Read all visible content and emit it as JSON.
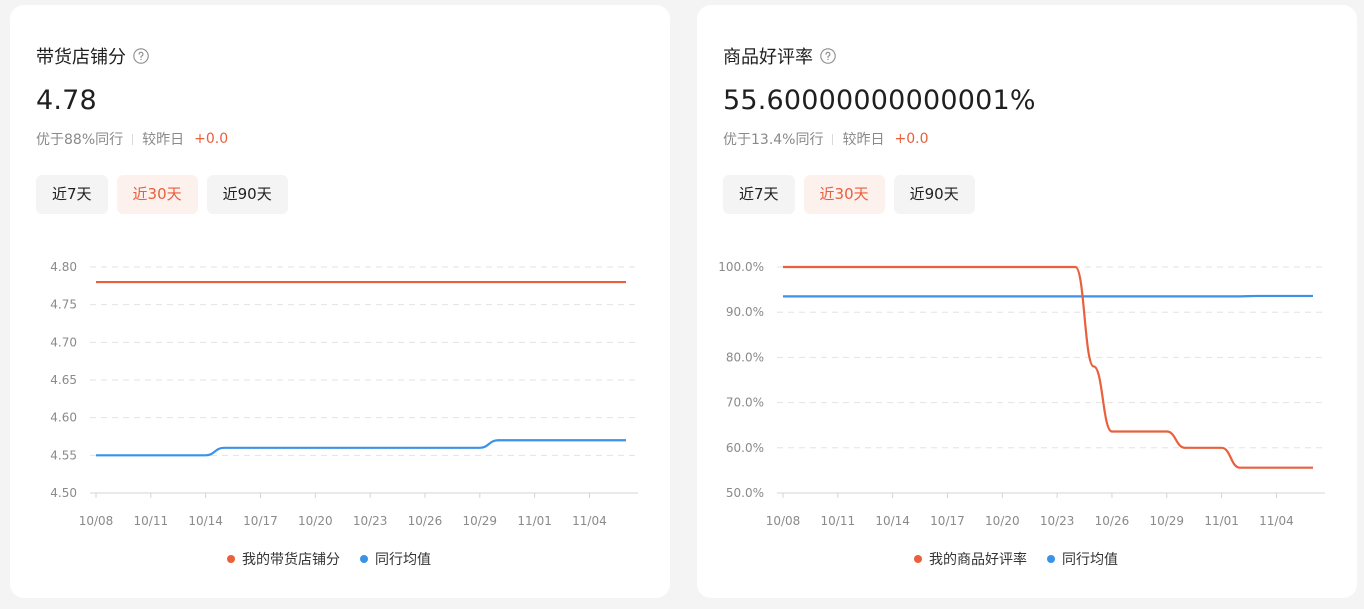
{
  "cards": [
    {
      "title": "带货店铺分",
      "value": "4.78",
      "compare": "优于88%同行",
      "day_label": "较昨日",
      "delta": "+0.0",
      "tabs": [
        "近7天",
        "近30天",
        "近90天"
      ],
      "active_tab": "近30天",
      "colors": {
        "mine": "#e8603c",
        "peer": "#3a93e8"
      }
    },
    {
      "title": "商品好评率",
      "value": "55.60000000000001%",
      "compare": "优于13.4%同行",
      "day_label": "较昨日",
      "delta": "+0.0",
      "tabs": [
        "近7天",
        "近30天",
        "近90天"
      ],
      "active_tab": "近30天",
      "colors": {
        "mine": "#e8603c",
        "peer": "#3a93e8"
      }
    }
  ],
  "chart_data": [
    {
      "type": "line",
      "x": [
        "10/08",
        "10/09",
        "10/10",
        "10/11",
        "10/12",
        "10/13",
        "10/14",
        "10/15",
        "10/16",
        "10/17",
        "10/18",
        "10/19",
        "10/20",
        "10/21",
        "10/22",
        "10/23",
        "10/24",
        "10/25",
        "10/26",
        "10/27",
        "10/28",
        "10/29",
        "10/30",
        "10/31",
        "11/01",
        "11/02",
        "11/03",
        "11/04",
        "11/05",
        "11/06"
      ],
      "xticks": [
        "10/08",
        "10/11",
        "10/14",
        "10/17",
        "10/20",
        "10/23",
        "10/26",
        "10/29",
        "11/01",
        "11/04"
      ],
      "yticks": [
        "4.80",
        "4.75",
        "4.70",
        "4.65",
        "4.60",
        "4.55",
        "4.50"
      ],
      "ylim": [
        4.5,
        4.8
      ],
      "grid": true,
      "legend_position": "bottom-center",
      "series": [
        {
          "name": "我的带货店铺分",
          "values": [
            4.78,
            4.78,
            4.78,
            4.78,
            4.78,
            4.78,
            4.78,
            4.78,
            4.78,
            4.78,
            4.78,
            4.78,
            4.78,
            4.78,
            4.78,
            4.78,
            4.78,
            4.78,
            4.78,
            4.78,
            4.78,
            4.78,
            4.78,
            4.78,
            4.78,
            4.78,
            4.78,
            4.78,
            4.78,
            4.78
          ]
        },
        {
          "name": "同行均值",
          "values": [
            4.55,
            4.55,
            4.55,
            4.55,
            4.55,
            4.55,
            4.55,
            4.56,
            4.56,
            4.56,
            4.56,
            4.56,
            4.56,
            4.56,
            4.56,
            4.56,
            4.56,
            4.56,
            4.56,
            4.56,
            4.56,
            4.56,
            4.57,
            4.57,
            4.57,
            4.57,
            4.57,
            4.57,
            4.57,
            4.57
          ]
        }
      ]
    },
    {
      "type": "line",
      "x": [
        "10/08",
        "10/09",
        "10/10",
        "10/11",
        "10/12",
        "10/13",
        "10/14",
        "10/15",
        "10/16",
        "10/17",
        "10/18",
        "10/19",
        "10/20",
        "10/21",
        "10/22",
        "10/23",
        "10/24",
        "10/25",
        "10/26",
        "10/27",
        "10/28",
        "10/29",
        "10/30",
        "10/31",
        "11/01",
        "11/02",
        "11/03",
        "11/04",
        "11/05",
        "11/06"
      ],
      "xticks": [
        "10/08",
        "10/11",
        "10/14",
        "10/17",
        "10/20",
        "10/23",
        "10/26",
        "10/29",
        "11/01",
        "11/04"
      ],
      "yticks": [
        "100.0%",
        "90.0%",
        "80.0%",
        "70.0%",
        "60.0%",
        "50.0%"
      ],
      "ylim": [
        50,
        100
      ],
      "grid": true,
      "legend_position": "bottom-center",
      "series": [
        {
          "name": "我的商品好评率",
          "values": [
            100,
            100,
            100,
            100,
            100,
            100,
            100,
            100,
            100,
            100,
            100,
            100,
            100,
            100,
            100,
            100,
            100,
            78,
            63.6,
            63.6,
            63.6,
            63.6,
            60,
            60,
            60,
            55.6,
            55.6,
            55.6,
            55.6,
            55.6
          ]
        },
        {
          "name": "同行均值",
          "values": [
            93.5,
            93.5,
            93.5,
            93.5,
            93.5,
            93.5,
            93.5,
            93.5,
            93.5,
            93.5,
            93.5,
            93.5,
            93.5,
            93.5,
            93.5,
            93.5,
            93.5,
            93.5,
            93.5,
            93.5,
            93.5,
            93.5,
            93.5,
            93.5,
            93.5,
            93.5,
            93.6,
            93.6,
            93.6,
            93.6
          ]
        }
      ]
    }
  ]
}
